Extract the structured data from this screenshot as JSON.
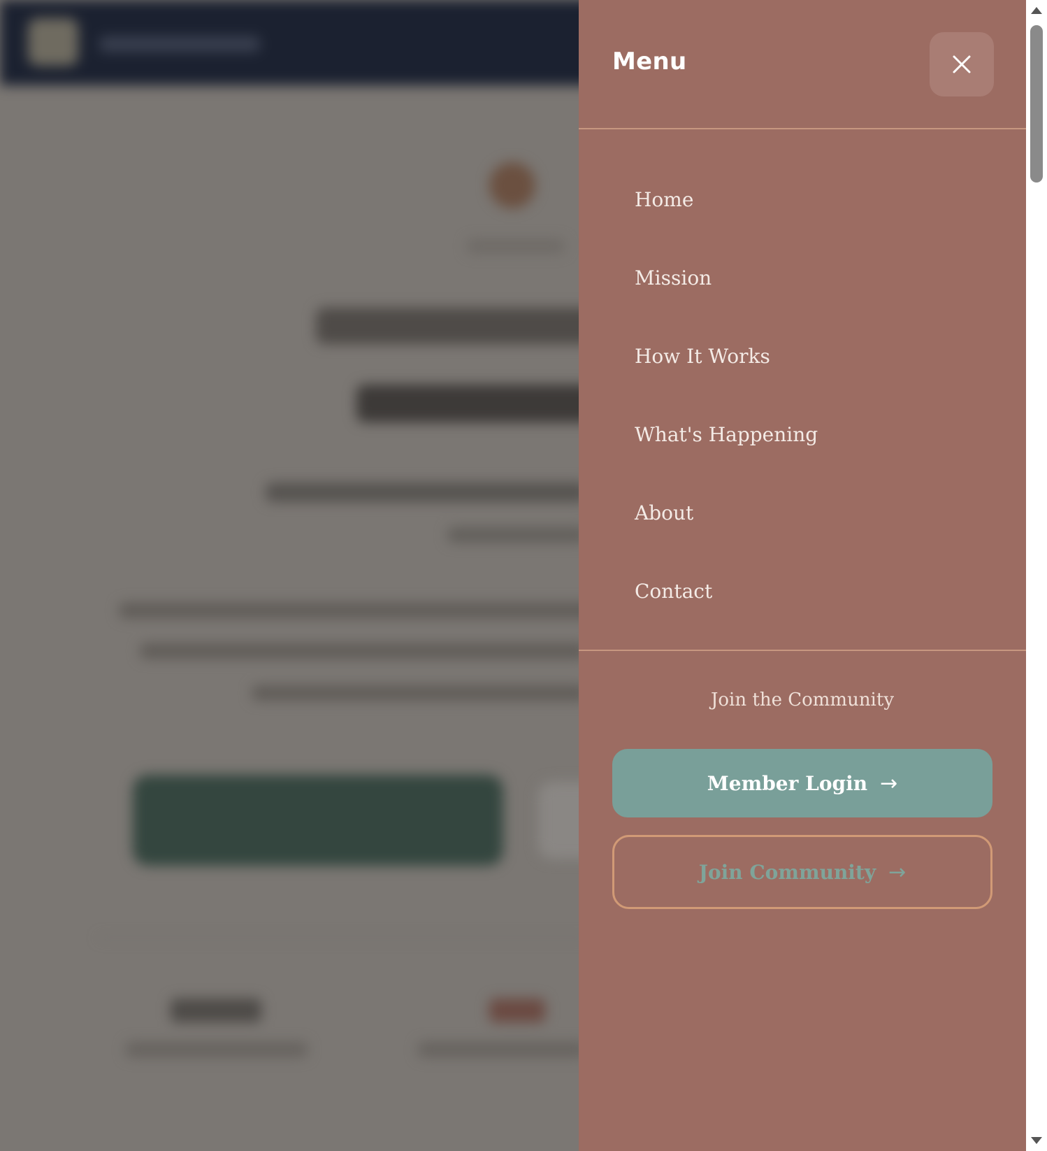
{
  "drawer": {
    "title": "Menu",
    "close_icon": "close-icon",
    "nav_items": [
      {
        "label": "Home"
      },
      {
        "label": "Mission"
      },
      {
        "label": "How It Works"
      },
      {
        "label": "What's Happening"
      },
      {
        "label": "About"
      },
      {
        "label": "Contact"
      }
    ],
    "join_heading": "Join the Community",
    "login_button": {
      "label": "Member Login",
      "arrow": "→"
    },
    "join_button": {
      "label": "Join Community",
      "arrow": "→"
    }
  },
  "colors": {
    "drawer_bg": "#9c6c62",
    "close_btn_bg": "#a97d74",
    "divider": "#c79780",
    "login_bg": "#799f99",
    "join_border": "#d19a76",
    "join_text": "#7fa49a",
    "header_bg": "#1b2130",
    "overlay": "#7b7773"
  }
}
